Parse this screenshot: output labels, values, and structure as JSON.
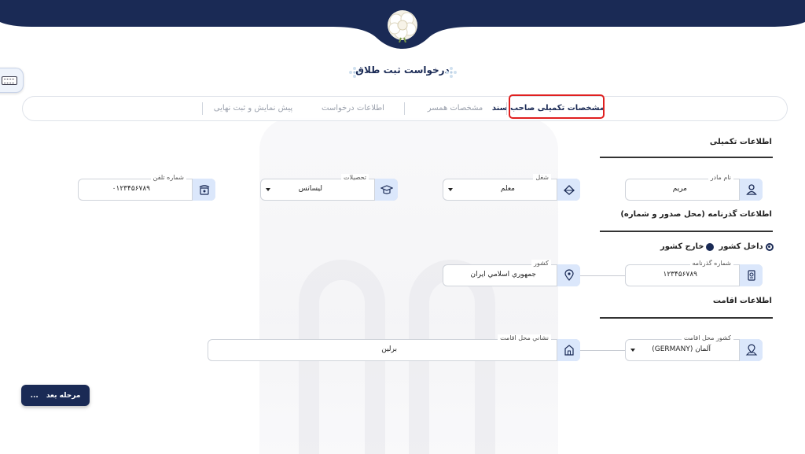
{
  "page_title": "درخواست ثبت طلاق",
  "steps": [
    {
      "label": "مشخصات تکمیلی صاحب سند",
      "active": true
    },
    {
      "label": "مشخصات همسر",
      "active": false
    },
    {
      "label": "اطلاعات درخواست",
      "active": false
    },
    {
      "label": "پیش نمایش و ثبت نهایی",
      "active": false
    }
  ],
  "sections": {
    "extra_info": "اطلاعات تکمیلی",
    "passport_info": "اطلاعات گذرنامه (محل صدور و شماره)",
    "residence_info": "اطلاعات اقامت"
  },
  "fields": {
    "mother_name": {
      "label": "نام مادر",
      "value": "مریم"
    },
    "job": {
      "label": "شغل",
      "value": "معلم"
    },
    "education": {
      "label": "تحصیلات",
      "value": "لیسانس"
    },
    "phone": {
      "label": "شماره تلفن",
      "value": "۰۱۲۳۴۵۶۷۸۹"
    },
    "passport_no": {
      "label": "شماره گذرنامه",
      "value": "۱۲۳۴۵۶۷۸۹"
    },
    "country": {
      "label": "کشور",
      "value": "جمهوري اسلامي ايران"
    },
    "residence_country": {
      "label": "کشور محل اقامت",
      "value": "آلمان (GERMANY)"
    },
    "residence_address": {
      "label": "نشاني محل اقامت",
      "value": "برلین"
    }
  },
  "radios": {
    "inside": "داخل کشور",
    "outside": "خارج کشور",
    "selected": "inside"
  },
  "next_button": {
    "label": "مرحله بعد",
    "arrow": "..."
  },
  "colors": {
    "primary": "#1a2a55",
    "accent": "#dbe7fb",
    "highlight": "#e02020"
  }
}
